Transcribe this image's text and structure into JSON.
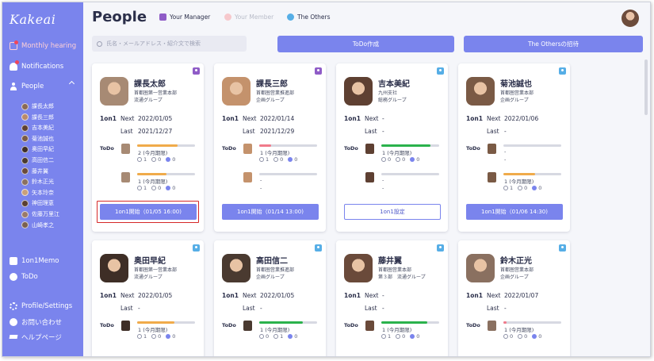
{
  "app": {
    "logo": "Kakeai"
  },
  "sidebar": {
    "monthly_hearing": "Monthly hearing",
    "notifications": "Notifications",
    "people": "People",
    "people_list": [
      {
        "name": "課長太郎",
        "color": "#8a6a55"
      },
      {
        "name": "課長三郎",
        "color": "#b98a6a"
      },
      {
        "name": "吉本美紀",
        "color": "#5e4032"
      },
      {
        "name": "菊池誠也",
        "color": "#7a5a45"
      },
      {
        "name": "奥田早紀",
        "color": "#3e2e26"
      },
      {
        "name": "高田信二",
        "color": "#4a3a30"
      },
      {
        "name": "藤井翼",
        "color": "#6a4a3a"
      },
      {
        "name": "鈴木正光",
        "color": "#8a7060"
      },
      {
        "name": "矢本玲奈",
        "color": "#c9a07a"
      },
      {
        "name": "神田理恵",
        "color": "#5a3f34"
      },
      {
        "name": "佐藤万里江",
        "color": "#9a7a6a"
      },
      {
        "name": "山崎孝之",
        "color": "#7a6050"
      }
    ],
    "memo": "1on1Memo",
    "todo": "ToDo",
    "profile": "Profile/Settings",
    "contact": "お問い合わせ",
    "help": "ヘルプページ"
  },
  "header": {
    "title": "People",
    "tab_manager": "Your Manager",
    "tab_member": "Your Member",
    "tab_others": "The Others"
  },
  "toolbar": {
    "search_placeholder": "氏名・メールアドレス・紹介文で検索",
    "todo_create": "ToDo作成",
    "invite": "The Othersの招待"
  },
  "labels": {
    "one_on_one": "1on1",
    "next": "Next",
    "last": "Last",
    "todo": "ToDo"
  },
  "cards": [
    {
      "name": "課長太郎",
      "dept1": "首都圏第一営業本部",
      "dept2": "流通グループ",
      "badge": "manager",
      "next": "2022/01/05",
      "last": "2021/12/27",
      "todos": [
        {
          "title": "2 (今月期限)",
          "progress": 0.7,
          "color": "#f0ab4a",
          "s1": "1",
          "s2": "0",
          "s3": "0"
        },
        {
          "title": "1 (今月期限)",
          "progress": 0.5,
          "color": "#f0ab4a",
          "s1": "1",
          "s2": "0",
          "s3": "0"
        }
      ],
      "button": "1on1開始（01/05 16:00)",
      "button_style": "fill",
      "highlight": true,
      "avatar": "#a78a74"
    },
    {
      "name": "課長三郎",
      "dept1": "首都圏営業推進部",
      "dept2": "企画グループ",
      "badge": "manager",
      "next": "2022/01/14",
      "last": "2021/12/29",
      "todos": [
        {
          "title": "1 (今月期限)",
          "progress": 0.2,
          "color": "#f07a8a",
          "s1": "1",
          "s2": "0",
          "s3": "0"
        },
        {
          "title": "-",
          "progress": 0,
          "color": "#f0ab4a",
          "s1": "",
          "s2": "",
          "s3": "",
          "extra": "-"
        }
      ],
      "button": "1on1開始（01/14 13:00)",
      "button_style": "fill",
      "highlight": false,
      "avatar": "#c4926c"
    },
    {
      "name": "吉本美紀",
      "dept1": "九州支社",
      "dept2": "総務グループ",
      "badge": "other",
      "next": "-",
      "last": "-",
      "todos": [
        {
          "title": "1 (今月期限)",
          "progress": 0.85,
          "color": "#2bb24c",
          "s1": "0",
          "s2": "0",
          "s3": "0"
        },
        {
          "title": "-",
          "progress": 0,
          "color": "#f0ab4a",
          "s1": "",
          "s2": "",
          "s3": "",
          "extra": "-"
        }
      ],
      "button": "1on1設定",
      "button_style": "outline",
      "highlight": false,
      "avatar": "#5e4032"
    },
    {
      "name": "菊池誠也",
      "dept1": "首都圏営業本部",
      "dept2": "企画グループ",
      "badge": "other",
      "next": "2022/01/06",
      "last": "-",
      "todos": [
        {
          "title": "-",
          "progress": 0,
          "color": "#f0ab4a",
          "s1": "",
          "s2": "",
          "s3": "",
          "extra": "-"
        },
        {
          "title": "1 (今月期限)",
          "progress": 0.55,
          "color": "#f0ab4a",
          "s1": "1",
          "s2": "0",
          "s3": "0"
        }
      ],
      "button": "1on1開始（01/06 14:30)",
      "button_style": "fill",
      "highlight": false,
      "avatar": "#7a5a45"
    },
    {
      "name": "奥田早紀",
      "dept1": "首都圏第一営業本部",
      "dept2": "流通グループ",
      "badge": "other",
      "next": "2022/01/05",
      "last": "-",
      "todos": [
        {
          "title": "1 (今月期限)",
          "progress": 0.65,
          "color": "#f0ab4a",
          "s1": "1",
          "s2": "0",
          "s3": "0"
        }
      ],
      "avatar": "#3e2e26"
    },
    {
      "name": "高田信二",
      "dept1": "首都圏営業推進部",
      "dept2": "企画グループ",
      "badge": "other",
      "next": "2022/01/05",
      "last": "-",
      "todos": [
        {
          "title": "1 (今月期限)",
          "progress": 0.75,
          "color": "#2bb24c",
          "s1": "0",
          "s2": "1",
          "s3": "0"
        }
      ],
      "avatar": "#4a3a30"
    },
    {
      "name": "藤井翼",
      "dept1": "首都圏営業本部",
      "dept2": "第３部　流通グループ",
      "badge": "other",
      "next": "-",
      "last": "-",
      "todos": [
        {
          "title": "1 (今月期限)",
          "progress": 0.8,
          "color": "#2bb24c",
          "s1": "1",
          "s2": "0",
          "s3": "0"
        }
      ],
      "avatar": "#6a4a3a"
    },
    {
      "name": "鈴木正光",
      "dept1": "首都圏営業本部",
      "dept2": "企画グループ",
      "badge": "other",
      "next": "2022/01/07",
      "last": "-",
      "todos": [
        {
          "title": "1 (今月期限)",
          "progress": 0.05,
          "color": "#f07a8a",
          "s1": "0",
          "s2": "0",
          "s3": "0"
        }
      ],
      "avatar": "#8a7060"
    }
  ]
}
